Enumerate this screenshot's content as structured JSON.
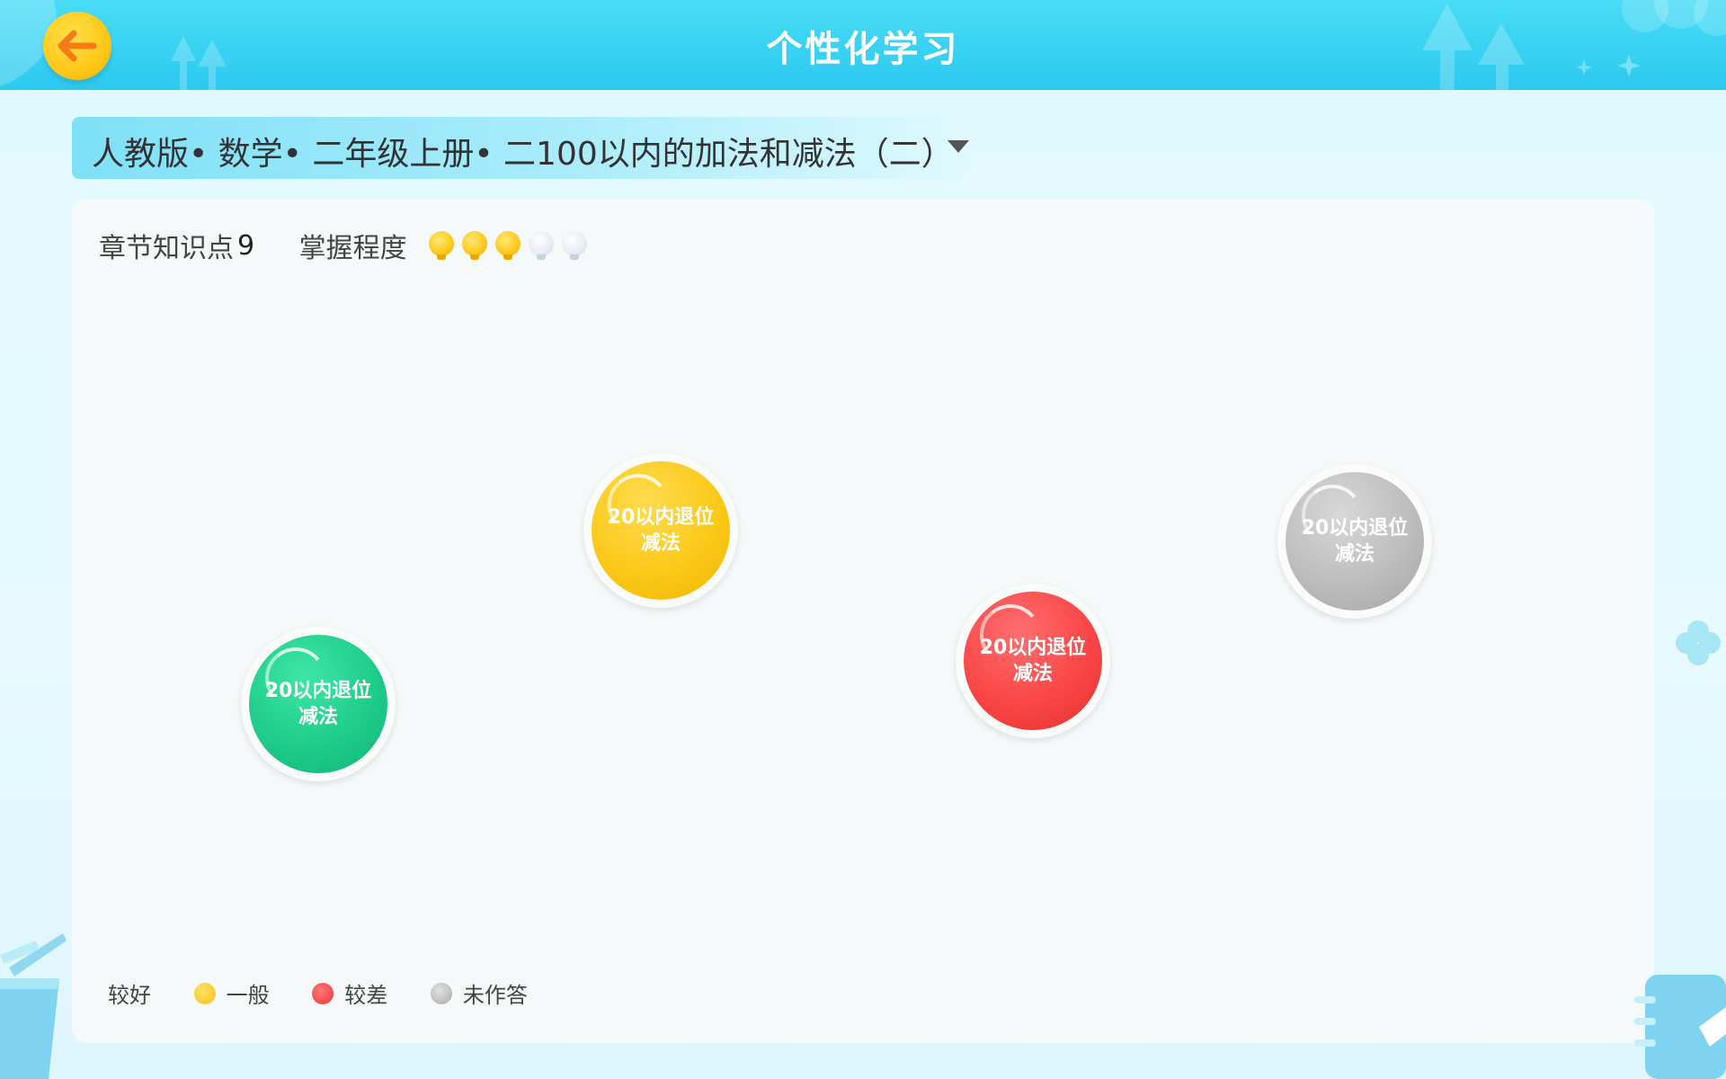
{
  "header": {
    "title": "个性化学习",
    "back_icon": "back-arrow-icon"
  },
  "selector": {
    "text": "人教版• 数学• 二年级上册• 二100以内的加法和减法（二）",
    "caret_icon": "caret-down-icon"
  },
  "stats": {
    "knowledge_label": "章节知识点",
    "knowledge_count": "9",
    "mastery_label": "掌握程度",
    "mastery_level": 3,
    "mastery_max": 5
  },
  "nodes": [
    {
      "label": "20以内退位减法",
      "status": "good",
      "color": "#1fcc8a"
    },
    {
      "label": "20以内退位减法",
      "status": "average",
      "color": "#fbc919"
    },
    {
      "label": "20以内退位减法",
      "status": "poor",
      "color": "#fa4646"
    },
    {
      "label": "20以内退位减法",
      "status": "unanswered",
      "color": "#bdbdbd"
    }
  ],
  "legend": {
    "good": "较好",
    "average": "一般",
    "poor": "较差",
    "unanswered": "未作答"
  },
  "colors": {
    "header": "#2cc9ef",
    "accent_yellow": "#ffc818"
  }
}
